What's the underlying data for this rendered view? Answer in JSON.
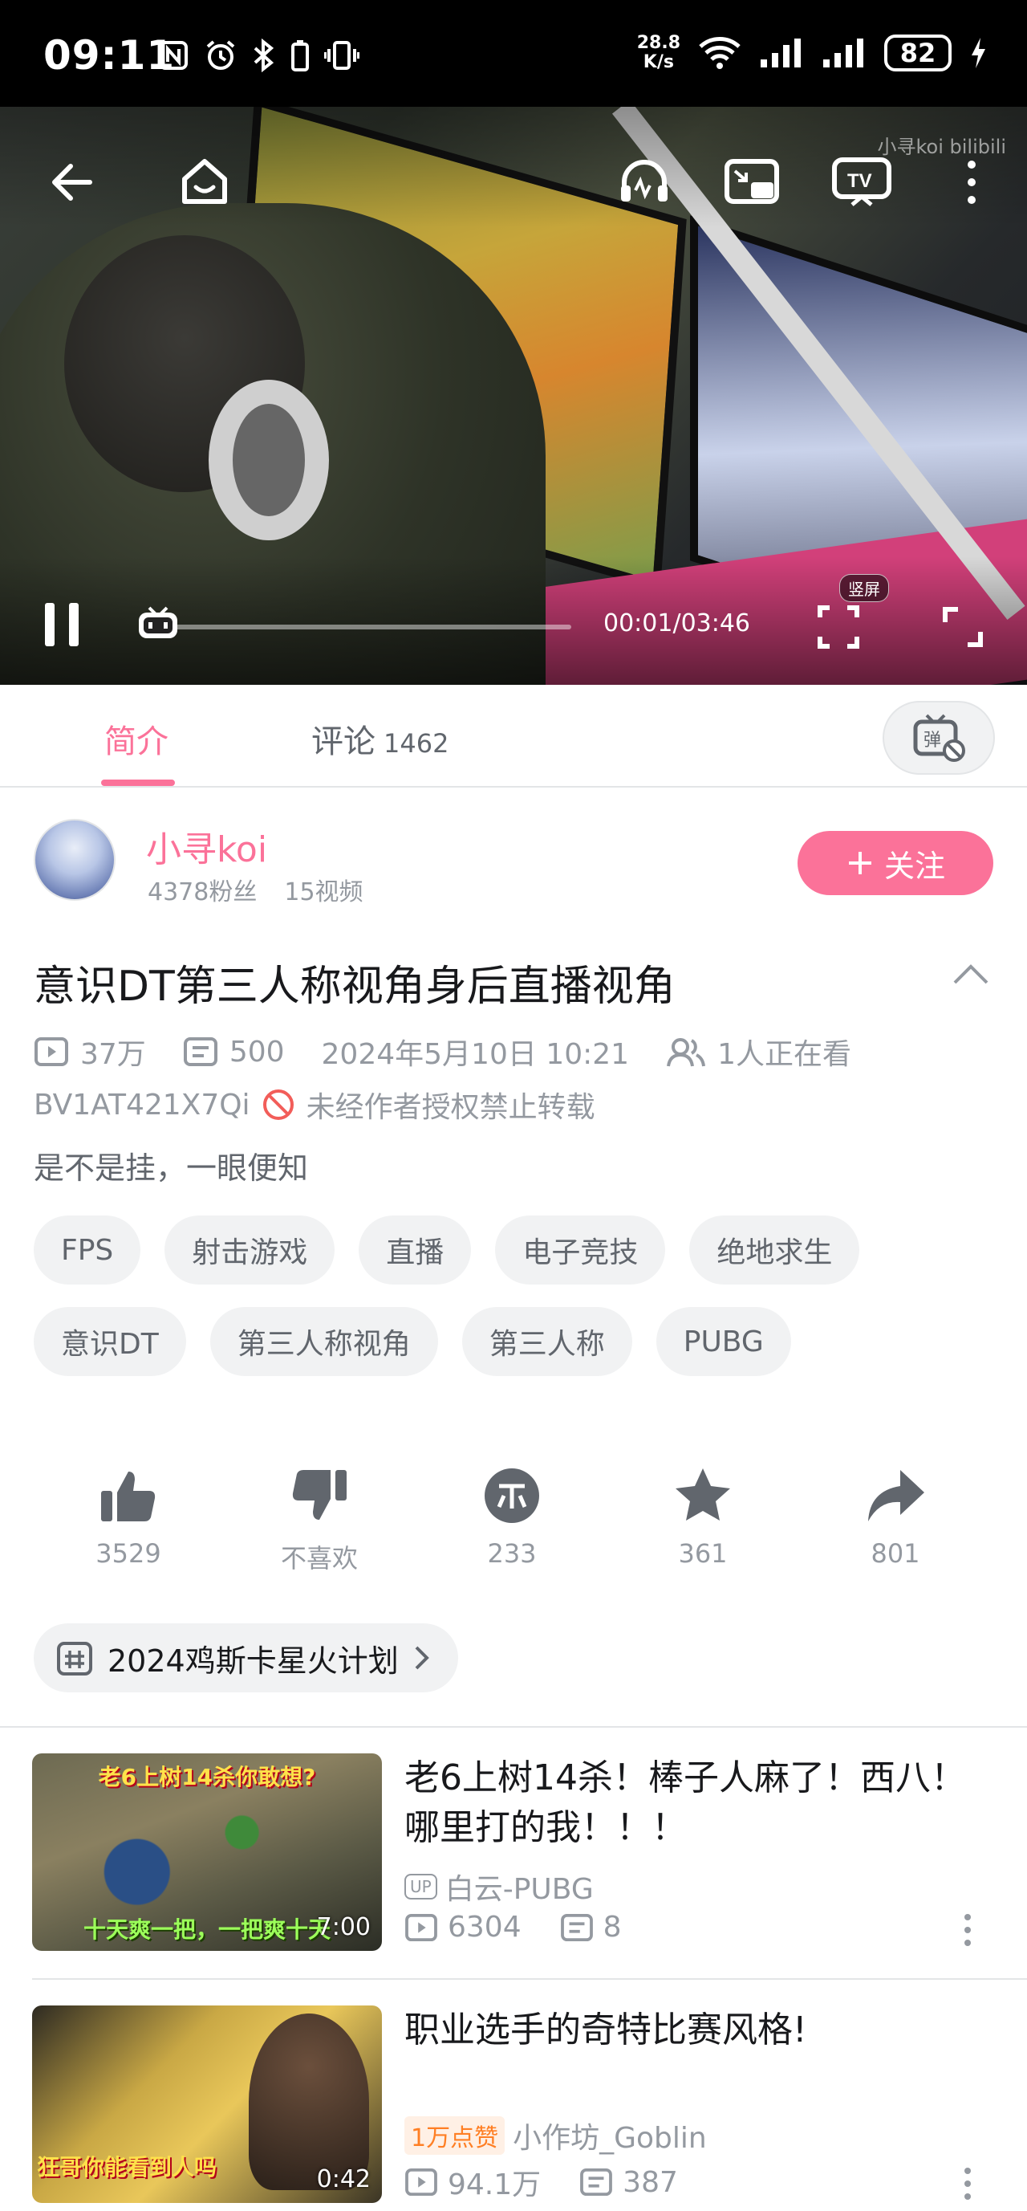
{
  "status_bar": {
    "time": "09:11",
    "net_speed_value": "28.8",
    "net_speed_unit": "K/s",
    "battery": "82"
  },
  "player": {
    "watermark": "小寻koi  bilibili",
    "current_time": "00:01",
    "duration": "03:46",
    "time_text": "00:01/03:46",
    "progress": 0.005,
    "vertical_label": "竖屏"
  },
  "tabs": {
    "intro_label": "简介",
    "comments_label": "评论",
    "comments_count": "1462"
  },
  "uploader": {
    "name": "小寻koi",
    "fans": "4378粉丝",
    "videos": "15视频",
    "follow_label": "关注"
  },
  "video_info": {
    "title": "意识DT第三人称视角身后直播视角",
    "views": "37万",
    "danmaku": "500",
    "date": "2024年5月10日 10:21",
    "watching": "1人正在看",
    "bvid": "BV1AT421X7Qi",
    "copyright": "未经作者授权禁止转载",
    "description": "是不是挂，一眼便知"
  },
  "tags": [
    "FPS",
    "射击游戏",
    "直播",
    "电子竞技",
    "绝地求生",
    "意识DT",
    "第三人称视角",
    "第三人称",
    "PUBG"
  ],
  "actions": {
    "like": "3529",
    "dislike": "不喜欢",
    "coin": "233",
    "favorite": "361",
    "share": "801"
  },
  "activity": {
    "label": "2024鸡斯卡星火计划"
  },
  "recommendations": [
    {
      "title": "老6上树14杀！棒子人麻了！西八！哪里打的我！！！",
      "uploader": "白云-PUBG",
      "up_badge": "UP",
      "views": "6304",
      "danmaku": "8",
      "duration": "7:00",
      "thumb_top_text": "老6上树14杀你敢想?",
      "thumb_bottom_text": "十天爽一把，一把爽十天"
    },
    {
      "title": "职业选手的奇特比赛风格!",
      "uploader": "小作坊_Goblin",
      "hot_badge": "1万点赞",
      "views": "94.1万",
      "danmaku": "387",
      "duration": "0:42",
      "thumb_bottom_text": "狂哥你能看到人吗"
    }
  ],
  "colors": {
    "accent": "#fb7299",
    "text_primary": "#18191c",
    "text_secondary": "#9499a0",
    "tag_bg": "#f1f2f3",
    "icon_gray": "#61666d"
  }
}
